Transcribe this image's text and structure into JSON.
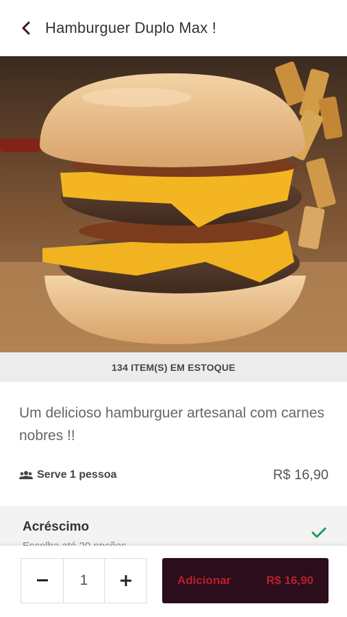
{
  "header": {
    "title": "Hamburguer Duplo Max !"
  },
  "product": {
    "stock": "134 ITEM(S) EM ESTOQUE",
    "description": "Um delicioso hamburguer artesanal com carnes nobres !!",
    "serves": "Serve 1 pessoa",
    "price": "R$ 16,90"
  },
  "extras": {
    "title": "Acréscimo",
    "subtitle": "Escolha até 20 opções"
  },
  "footer": {
    "quantity": "1",
    "add_label": "Adicionar",
    "add_price": "R$ 16,90"
  },
  "colors": {
    "brand": "#2b0d1b",
    "accent_text": "#b5202b",
    "check": "#1e9c5a"
  }
}
